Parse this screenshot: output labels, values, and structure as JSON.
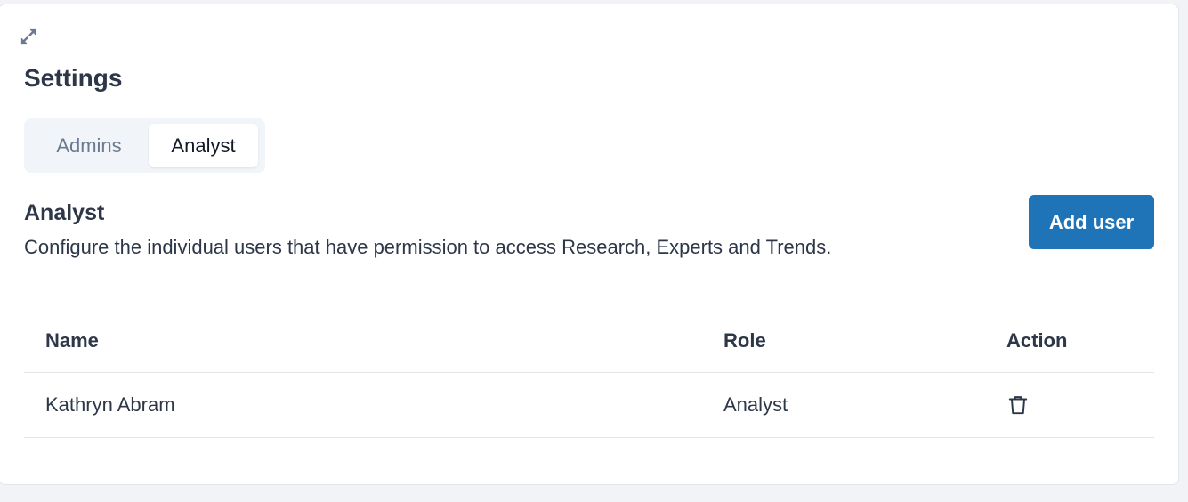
{
  "page": {
    "title": "Settings"
  },
  "tabs": [
    {
      "label": "Admins",
      "active": false
    },
    {
      "label": "Analyst",
      "active": true
    }
  ],
  "section": {
    "title": "Analyst",
    "description": "Configure the individual users that have permission to access Research, Experts and Trends."
  },
  "actions": {
    "add_user_label": "Add user"
  },
  "table": {
    "columns": [
      "Name",
      "Role",
      "Action"
    ],
    "rows": [
      {
        "name": "Kathryn Abram",
        "role": "Analyst",
        "action_icon": "trash-icon"
      }
    ]
  },
  "icons": {
    "expand": "expand-icon",
    "delete": "trash-icon"
  },
  "colors": {
    "accent": "#1f74b8",
    "text": "#2d3748",
    "muted": "#6b7a90"
  }
}
